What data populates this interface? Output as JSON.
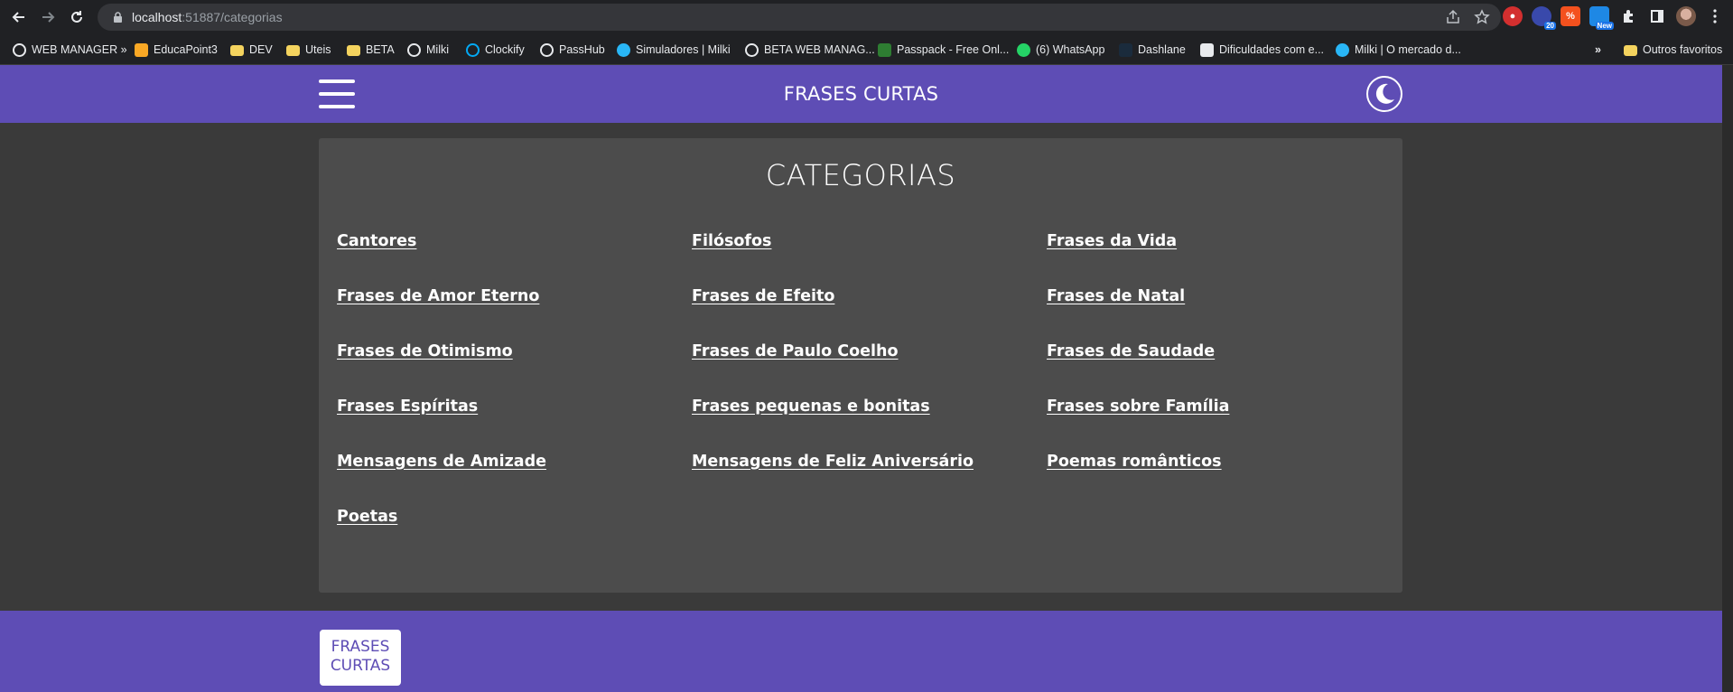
{
  "browser": {
    "url_host": "localhost",
    "url_path": ":51887/categorias",
    "bookmarks": [
      {
        "label": "WEB MANAGER »",
        "icon": "globe-icon"
      },
      {
        "label": "EducaPoint3",
        "icon": "educapoint-icon"
      },
      {
        "label": "DEV",
        "icon": "folder-icon"
      },
      {
        "label": "Uteis",
        "icon": "folder-icon"
      },
      {
        "label": "BETA",
        "icon": "folder-icon"
      },
      {
        "label": "Milki",
        "icon": "globe-icon"
      },
      {
        "label": "Clockify",
        "icon": "clockify-icon"
      },
      {
        "label": "PassHub",
        "icon": "globe-icon"
      },
      {
        "label": "Simuladores | Milki",
        "icon": "milki-icon"
      },
      {
        "label": "BETA WEB MANAG...",
        "icon": "globe-icon"
      },
      {
        "label": "Passpack - Free Onl...",
        "icon": "passpack-icon"
      },
      {
        "label": "(6) WhatsApp",
        "icon": "whatsapp-icon"
      },
      {
        "label": "Dashlane",
        "icon": "dashlane-icon"
      },
      {
        "label": "Dificuldades com e...",
        "icon": "page-icon"
      },
      {
        "label": "Milki | O mercado d...",
        "icon": "milki-icon"
      }
    ],
    "more_bookmarks": "»",
    "other_favorites": "Outros favoritos",
    "extension_badges": {
      "badge_20": "20",
      "badge_new": "New"
    }
  },
  "header": {
    "title": "FRASES CURTAS"
  },
  "main": {
    "title": "CATEGORIAS",
    "categories": [
      "Cantores",
      "Filósofos",
      "Frases da Vida",
      "Frases de Amor Eterno",
      "Frases de Efeito",
      "Frases de Natal",
      "Frases de Otimismo",
      "Frases de Paulo Coelho",
      "Frases de Saudade",
      "Frases Espíritas",
      "Frases pequenas e bonitas",
      "Frases sobre Família",
      "Mensagens de Amizade",
      "Mensagens de Feliz Aniversário",
      "Poemas românticos",
      "Poetas"
    ]
  },
  "footer": {
    "logo_line1": "FRASES",
    "logo_line2": "CURTAS"
  },
  "colors": {
    "brand": "#5e4db5",
    "page_bg": "#3a3a3a",
    "card_bg": "#4c4c4c"
  }
}
